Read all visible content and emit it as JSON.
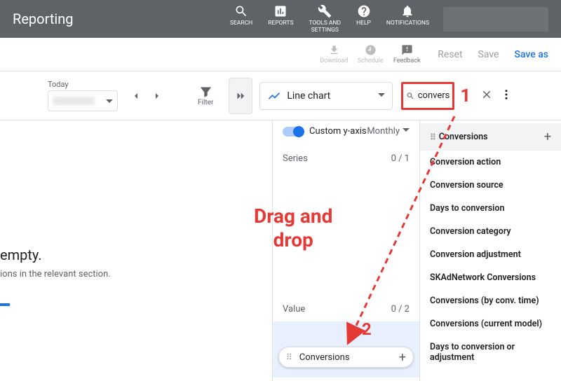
{
  "header": {
    "title": "Reporting"
  },
  "topnav": {
    "search": "SEARCH",
    "reports": "REPORTS",
    "tools": "TOOLS AND\nSETTINGS",
    "help": "HELP",
    "notifications": "NOTIFICATIONS"
  },
  "actions": {
    "download": "Download",
    "schedule": "Schedule",
    "feedback": "Feedback",
    "reset": "Reset",
    "save": "Save",
    "saveas": "Save as"
  },
  "daterange": {
    "label": "Today"
  },
  "filter": {
    "label": "Filter"
  },
  "chart": {
    "type_label": "Line chart",
    "toggle_label": "Custom y-axis",
    "period": "Monthly",
    "series_label": "Series",
    "series_count": "0 / 1",
    "value_label": "Value",
    "value_count": "0 / 2",
    "chip": "Conversions"
  },
  "search": {
    "query": "convers"
  },
  "metrics": [
    "Conversions",
    "Conversion action",
    "Conversion source",
    "Days to conversion",
    "Conversion category",
    "Conversion adjustment",
    "SKAdNetwork Conversions",
    "Conversions (by conv. time)",
    "Conversions (current model)",
    "Days to conversion or adjustment"
  ],
  "annotations": {
    "one": "1",
    "two": "2",
    "drag": "Drag and\ndrop"
  },
  "body": {
    "empty": "empty.",
    "sub": "ions in the relevant section."
  }
}
